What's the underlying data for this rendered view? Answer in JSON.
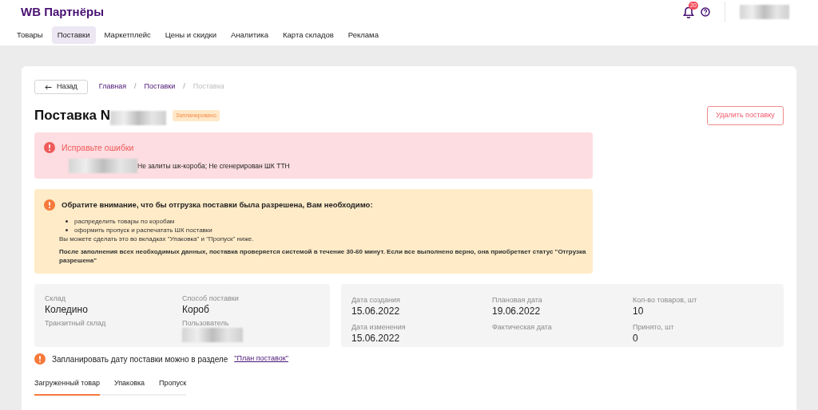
{
  "header": {
    "logo": "WB Партнёры",
    "notifications_count": "20"
  },
  "nav": [
    {
      "label": "Товары",
      "selected": false
    },
    {
      "label": "Поставки",
      "selected": true
    },
    {
      "label": "Маркетплейс",
      "selected": false
    },
    {
      "label": "Цены и скидки",
      "selected": false
    },
    {
      "label": "Аналитика",
      "selected": false
    },
    {
      "label": "Карта складов",
      "selected": false
    },
    {
      "label": "Реклама",
      "selected": false
    }
  ],
  "back_button": "Назад",
  "breadcrumb_separator": "/",
  "breadcrumbs": [
    {
      "label": "Главная",
      "current": false
    },
    {
      "label": "Поставки",
      "current": false
    },
    {
      "label": "Поставка",
      "current": true
    }
  ],
  "title": "Поставка N",
  "status_badge": "Запланировано",
  "delete_button": "Удалить поставку",
  "error_alert": {
    "title": "Исправьте ошибки",
    "message": "Не залиты шк-короба; Не сгенерирован ШК ТТН"
  },
  "warning_alert": {
    "title": "Обратите внимание, что бы отгрузка поставки была разрешена, Вам необходимо:",
    "items": [
      "распределить товары по коробам",
      "оформить пропуск и распечатать ШК поставки"
    ],
    "note": "Вы можете сделать это во вкладках \"Упаковка\" и \"Пропуск\" ниже.",
    "footer": "После заполнения всех необходимых данных, поставка проверяется системой в течение 30-60 минут. Если все выполнено верно, она приобретает статус \"Отгрузка разрешена\""
  },
  "info_left": [
    {
      "label": "Склад",
      "value": "Коледино"
    },
    {
      "label": "Способ поставки",
      "value": "Короб"
    },
    {
      "label": "Транзитный склад"
    },
    {
      "label": "Пользователь",
      "redacted": true
    }
  ],
  "info_right": [
    {
      "label": "Дата создания",
      "value": "15.06.2022"
    },
    {
      "label": "Плановая дата",
      "value": "19.06.2022"
    },
    {
      "label": "Кол-во товаров, шт",
      "value": "10"
    },
    {
      "label": "Дата изменения",
      "value": "15.06.2022"
    },
    {
      "label": "Фактическая дата"
    },
    {
      "label": "Принято, шт",
      "value": "0"
    }
  ],
  "plan_hint": {
    "text": "Запланировать дату поставки можно в разделе",
    "link": "\"План поставок\""
  },
  "tabs": [
    {
      "label": "Загруженный товар",
      "selected": true
    },
    {
      "label": "Упаковка",
      "selected": false
    },
    {
      "label": "Пропуск",
      "selected": false
    }
  ]
}
